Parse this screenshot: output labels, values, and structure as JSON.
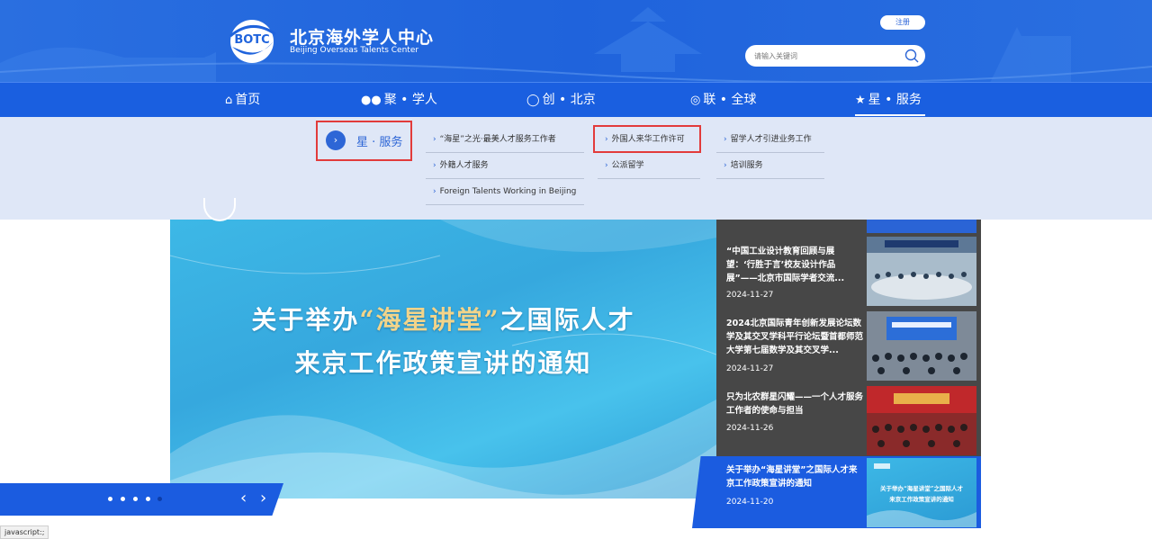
{
  "header": {
    "logo_text": "BOTC",
    "brand_cn": "北京海外学人中心",
    "brand_en": "Beijing Overseas Talents Center",
    "register_label": "注册",
    "search_placeholder": "请输入关键词",
    "colors": {
      "primary": "#1f63dc",
      "nav": "#1a5fe0",
      "highlight": "#e23b3b"
    }
  },
  "nav": {
    "items": [
      {
        "label": "首页",
        "icon": "home-icon"
      },
      {
        "label": "聚 • 学人",
        "icon": "users-icon"
      },
      {
        "label": "创 • 北京",
        "icon": "lightbulb-icon"
      },
      {
        "label": "联 • 全球",
        "icon": "globe-icon"
      },
      {
        "label": "星 • 服务",
        "icon": "star-icon"
      }
    ]
  },
  "dropdown": {
    "title": "星 · 服务",
    "links": [
      "“海星”之光·最美人才服务工作者",
      "外国人来华工作许可",
      "留学人才引进业务工作",
      "外籍人才服务",
      "公派留学",
      "培训服务",
      "Foreign Talents Working in Beijing"
    ]
  },
  "banner": {
    "line1_a": "关于举办",
    "line1_q": "“海星讲堂”",
    "line1_b": "之国际人才",
    "line2": "来京工作政策宣讲的通知",
    "slide_count": 5,
    "active_slide": 5
  },
  "news": [
    {
      "title": "“中国工业设计教育回顾与展望：‘行胜于言’校友设计作品展”——北京市国际学者交流...",
      "date": "2024-11-27"
    },
    {
      "title": "2024北京国际青年创新发展论坛数学及其交叉学科平行论坛暨首都师范大学第七届数学及其交叉学...",
      "date": "2024-11-27"
    },
    {
      "title": "只为北农群星闪耀——一个人才服务工作者的使命与担当",
      "date": "2024-11-26"
    },
    {
      "title": "关于举办“海星讲堂”之国际人才来京工作政策宣讲的通知",
      "date": "2024-11-20"
    }
  ],
  "thumb4": {
    "line1": "关于举办“海星讲堂”之国际人才",
    "line2": "来京工作政策宣讲的通知"
  },
  "status_bar": "javascript:;"
}
